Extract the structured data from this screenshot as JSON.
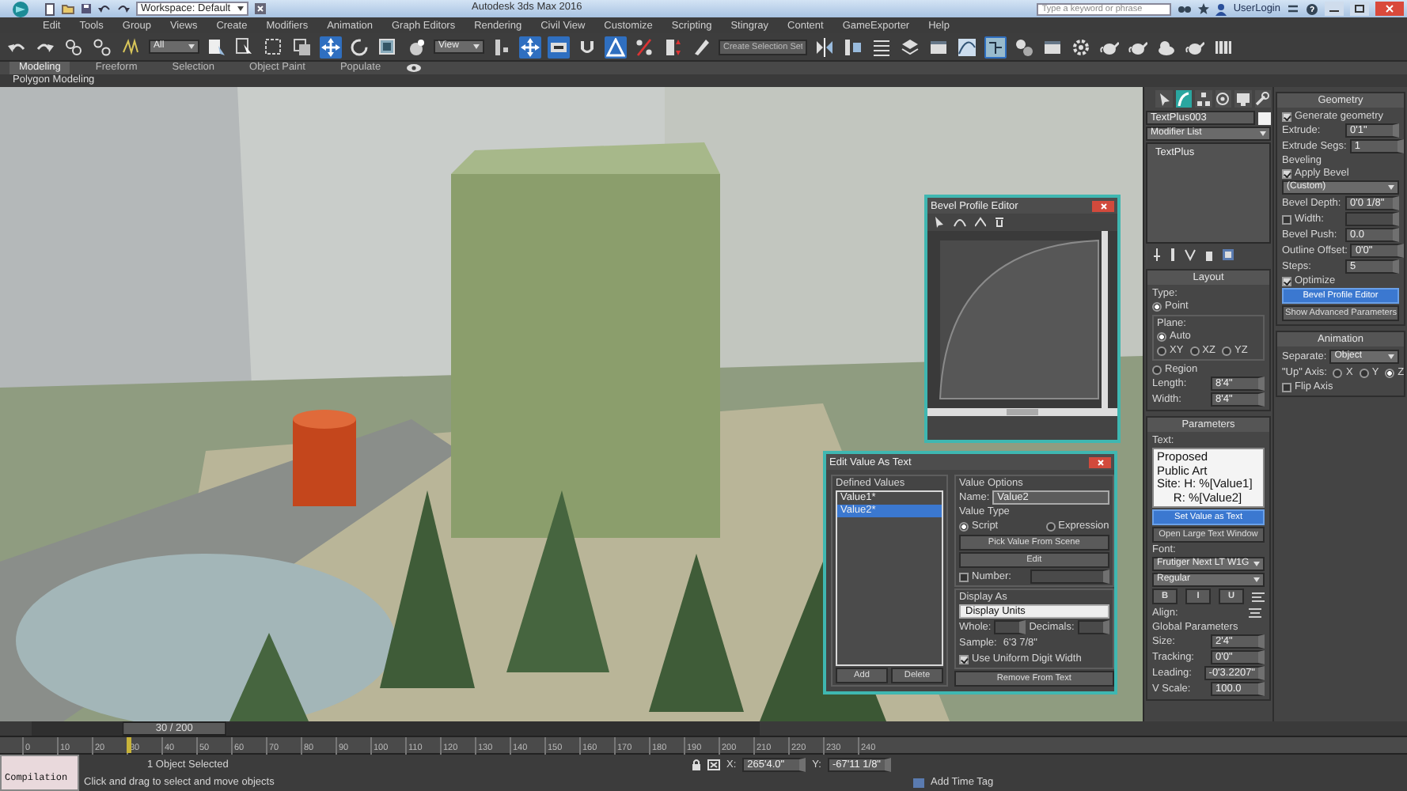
{
  "title_bar": {
    "workspace": "Workspace: Default",
    "title": "Autodesk 3ds Max 2016",
    "search": {
      "placeholder": "Type a keyword or phrase"
    },
    "user": "UserLogin"
  },
  "menu": [
    "Edit",
    "Tools",
    "Group",
    "Views",
    "Create",
    "Modifiers",
    "Animation",
    "Graph Editors",
    "Rendering",
    "Civil View",
    "Customize",
    "Scripting",
    "Stingray",
    "Content",
    "GameExporter",
    "Help"
  ],
  "toolbar": [
    {
      "kind": "undo",
      "selected": false
    },
    {
      "kind": "redo",
      "selected": false
    },
    {
      "kind": "link",
      "selected": false
    },
    {
      "kind": "unlink",
      "selected": false
    },
    {
      "kind": "bind",
      "selected": false
    },
    {
      "kind": "dropdown",
      "value": "All"
    },
    {
      "kind": "select_by_name",
      "selected": false
    },
    {
      "kind": "cursor",
      "selected": false
    },
    {
      "kind": "region",
      "selected": false
    },
    {
      "kind": "crossing",
      "selected": false
    },
    {
      "kind": "move",
      "selected": true
    },
    {
      "kind": "rotate",
      "selected": false
    },
    {
      "kind": "scale",
      "selected": false
    },
    {
      "kind": "place",
      "selected": false
    },
    {
      "kind": "dropdown",
      "value": "View"
    },
    {
      "kind": "pivot",
      "selected": false
    },
    {
      "kind": "move",
      "selected": true
    },
    {
      "kind": "keyboard",
      "selected": true
    },
    {
      "kind": "snap",
      "selected": false
    },
    {
      "kind": "angle_snap",
      "selected": true
    },
    {
      "kind": "percent_snap",
      "selected": false
    },
    {
      "kind": "spinner_snap",
      "selected": false
    },
    {
      "kind": "pencil",
      "selected": false
    },
    {
      "kind": "field",
      "placeholder": "Create Selection Set"
    },
    {
      "kind": "mirror",
      "selected": false
    },
    {
      "kind": "align",
      "selected": false
    },
    {
      "kind": "list",
      "selected": false
    },
    {
      "kind": "layers",
      "selected": false
    },
    {
      "kind": "window",
      "selected": false
    },
    {
      "kind": "curve",
      "selected": false
    },
    {
      "kind": "schematic",
      "selected": true
    },
    {
      "kind": "material",
      "selected": false
    },
    {
      "kind": "window",
      "selected": false
    },
    {
      "kind": "gear",
      "selected": false
    },
    {
      "kind": "teapot",
      "selected": false
    },
    {
      "kind": "teapot",
      "selected": false
    },
    {
      "kind": "cloud",
      "selected": false
    },
    {
      "kind": "teapot",
      "selected": false
    },
    {
      "kind": "film",
      "selected": false
    }
  ],
  "ribbon_tabs": [
    {
      "label": "Modeling",
      "selected": true
    },
    {
      "label": "Freeform",
      "selected": false
    },
    {
      "label": "Selection",
      "selected": false
    },
    {
      "label": "Object Paint",
      "selected": false
    },
    {
      "label": "Populate",
      "selected": false
    }
  ],
  "ribbon_panel": "Polygon Modeling",
  "bevel_profile_editor": {
    "title": "Bevel Profile Editor"
  },
  "edit_value_dialog": {
    "title": "Edit Value As Text",
    "defined_values": {
      "label": "Defined Values",
      "items": [
        {
          "label": "Value1*",
          "selected": false
        },
        {
          "label": "Value2*",
          "selected": true
        }
      ]
    },
    "add_button": "Add",
    "delete_button": "Delete",
    "value_options": {
      "label": "Value Options",
      "name_label": "Name:",
      "name": "Value2",
      "value_type": {
        "label": "Value Type",
        "options": [
          {
            "label": "Script",
            "selected": true
          },
          {
            "label": "Expression",
            "selected": false
          }
        ]
      },
      "pick_button": "Pick Value From Scene",
      "edit_button": "Edit",
      "number": {
        "label": "Number:",
        "checked": false
      },
      "display_as": {
        "label": "Display As",
        "mode": "Display Units",
        "whole_label": "Whole:",
        "decimals_label": "Decimals:",
        "sample_label": "Sample:",
        "sample": "6'3 7/8\"",
        "uniform": {
          "label": "Use Uniform Digit Width",
          "checked": true
        }
      },
      "remove_button": "Remove From Text"
    }
  },
  "command_panel": {
    "tabs": [
      {
        "kind": "create",
        "selected": false
      },
      {
        "kind": "modify",
        "selected": true
      },
      {
        "kind": "hierarchy",
        "selected": false
      },
      {
        "kind": "motion",
        "selected": false
      },
      {
        "kind": "display",
        "selected": false
      },
      {
        "kind": "utilities",
        "selected": false
      }
    ],
    "object_name": "TextPlus003",
    "modifier_list": "Modifier List",
    "stack": [
      "TextPlus"
    ],
    "left_rollouts": [
      {
        "title": "Layout",
        "rows": [
          {
            "kind": "heading",
            "label": "Type:"
          },
          {
            "kind": "radio",
            "label": "Point",
            "selected": true
          },
          {
            "kind": "group",
            "label": "Plane:",
            "children": [
              {
                "kind": "radio",
                "label": "Auto",
                "selected": true
              },
              {
                "kind": "radios",
                "options": [
                  {
                    "label": "XY",
                    "selected": false
                  },
                  {
                    "label": "XZ",
                    "selected": false
                  },
                  {
                    "label": "YZ",
                    "selected": false
                  }
                ]
              }
            ]
          },
          {
            "kind": "radio",
            "label": "Region",
            "selected": false
          },
          {
            "kind": "spinner",
            "label": "Length:",
            "value": "8'4\""
          },
          {
            "kind": "spinner",
            "label": "Width:",
            "value": "8'4\""
          }
        ]
      },
      {
        "title": "Parameters",
        "rows": [
          {
            "kind": "heading",
            "label": "Text:"
          },
          {
            "kind": "textarea",
            "value": "Proposed\nPublic Art\nSite: H: %[Value1]\n     R: %[Value2]"
          },
          {
            "kind": "button",
            "label": "Set Value as Text",
            "active": true
          },
          {
            "kind": "button",
            "label": "Open Large Text Window",
            "active": false
          },
          {
            "kind": "heading",
            "label": "Font:"
          },
          {
            "kind": "dropdown",
            "value": "Frutiger Next LT W1G"
          },
          {
            "kind": "dropdown",
            "value": "Regular"
          },
          {
            "kind": "style_buttons",
            "options": [
              {
                "label": "B",
                "selected": false
              },
              {
                "label": "I",
                "selected": false
              },
              {
                "label": "U",
                "selected": false
              }
            ]
          },
          {
            "kind": "align",
            "label": "Align:"
          },
          {
            "kind": "heading",
            "label": "Global Parameters"
          },
          {
            "kind": "spinner",
            "label": "Size:",
            "value": "2'4\""
          },
          {
            "kind": "spinner",
            "label": "Tracking:",
            "value": "0'0\""
          },
          {
            "kind": "spinner",
            "label": "Leading:",
            "value": "-0'3.2207\""
          },
          {
            "kind": "spinner",
            "label": "V Scale:",
            "value": "100.0"
          }
        ]
      }
    ],
    "right_rollouts": [
      {
        "title": "Geometry",
        "rows": [
          {
            "kind": "check",
            "label": "Generate geometry",
            "checked": true
          },
          {
            "kind": "spinner",
            "label": "Extrude:",
            "value": "0'1\""
          },
          {
            "kind": "spinner",
            "label": "Extrude Segs:",
            "value": "1"
          },
          {
            "kind": "heading",
            "label": "Beveling"
          },
          {
            "kind": "check",
            "label": "Apply Bevel",
            "checked": true
          },
          {
            "kind": "dropdown",
            "value": "(Custom)"
          },
          {
            "kind": "spinner",
            "label": "Bevel Depth:",
            "value": "0'0 1/8\""
          },
          {
            "kind": "check_spinner",
            "label": "Width:",
            "checked": false
          },
          {
            "kind": "spinner",
            "label": "Bevel Push:",
            "value": "0.0"
          },
          {
            "kind": "spinner",
            "label": "Outline Offset:",
            "value": "0'0\""
          },
          {
            "kind": "spinner",
            "label": "Steps:",
            "value": "5"
          },
          {
            "kind": "check",
            "label": "Optimize",
            "checked": true
          },
          {
            "kind": "button",
            "label": "Bevel Profile Editor",
            "active": true
          },
          {
            "kind": "button",
            "label": "Show Advanced Parameters",
            "active": false
          }
        ]
      },
      {
        "title": "Animation",
        "rows": [
          {
            "kind": "dropdown",
            "label": "Separate:",
            "value": "Object"
          },
          {
            "kind": "radios",
            "label": "\"Up\" Axis:",
            "options": [
              {
                "label": "X",
                "selected": false
              },
              {
                "label": "Y",
                "selected": false
              },
              {
                "label": "Z",
                "selected": true
              }
            ]
          },
          {
            "kind": "check",
            "label": "Flip Axis",
            "checked": false
          }
        ]
      }
    ]
  },
  "time_slider": {
    "frame": "30 / 200",
    "level": 0.15
  },
  "timeline_ticks": [
    "0",
    "10",
    "20",
    "30",
    "40",
    "50",
    "60",
    "70",
    "80",
    "90",
    "100",
    "110",
    "120",
    "130",
    "140",
    "150",
    "160",
    "170",
    "180",
    "190",
    "200",
    "210",
    "220",
    "230",
    "240"
  ],
  "status": {
    "script": "Compilation",
    "selection": "1 Object Selected",
    "prompt": "Click and drag to select and move objects",
    "x_label": "X:",
    "x": "265'4.0\"",
    "y_label": "Y:",
    "y": "-67'11 1/8\"",
    "time_tag": "Add Time Tag"
  }
}
